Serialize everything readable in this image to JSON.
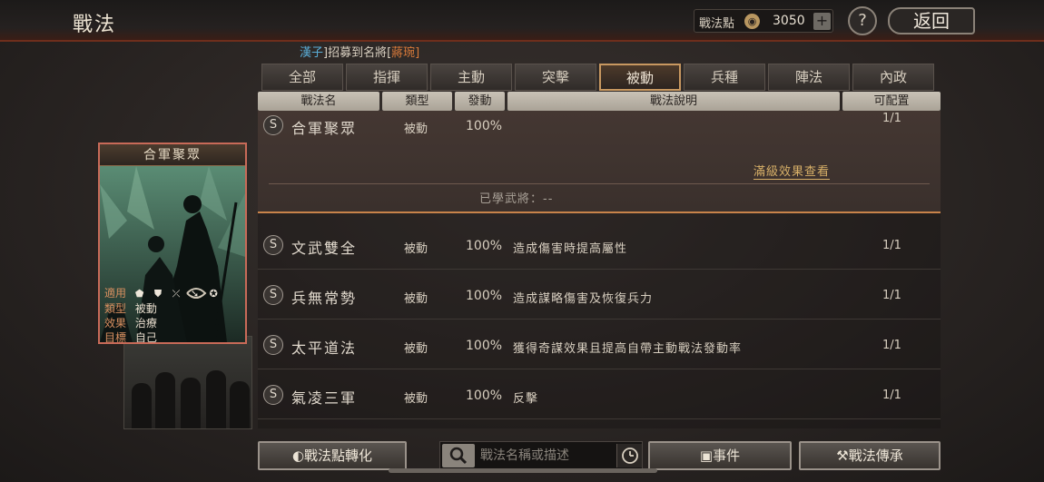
{
  "header": {
    "title": "戰法",
    "points_label": "戰法點",
    "points_value": "3050",
    "help_label": "?",
    "back_label": "返回"
  },
  "announcement": {
    "part1": "漢子",
    "part2": "]招募到名將[",
    "part3": "蔣琬]"
  },
  "tabs": [
    {
      "label": "全部"
    },
    {
      "label": "指揮"
    },
    {
      "label": "主動"
    },
    {
      "label": "突擊"
    },
    {
      "label": "被動"
    },
    {
      "label": "兵種"
    },
    {
      "label": "陣法"
    },
    {
      "label": "內政"
    }
  ],
  "active_tab": "被動",
  "columns": [
    "戰法名",
    "類型",
    "發動",
    "戰法說明",
    "可配置"
  ],
  "expanded": {
    "badge": "S",
    "name": "合軍聚眾",
    "type": "被動",
    "rate": "100%",
    "slots": "1/1",
    "full_effect_label": "滿級效果查看",
    "learned_label": "已學武將：--"
  },
  "rows": [
    {
      "badge": "S",
      "name": "文武雙全",
      "type": "被動",
      "rate": "100%",
      "desc": "造成傷害時提高屬性",
      "slots": "1/1"
    },
    {
      "badge": "S",
      "name": "兵無常勢",
      "type": "被動",
      "rate": "100%",
      "desc": "造成謀略傷害及恢復兵力",
      "slots": "1/1"
    },
    {
      "badge": "S",
      "name": "太平道法",
      "type": "被動",
      "rate": "100%",
      "desc": "獲得奇謀效果且提高自帶主動戰法發動率",
      "slots": "1/1"
    },
    {
      "badge": "S",
      "name": "氣凌三軍",
      "type": "被動",
      "rate": "100%",
      "desc": "反擊",
      "slots": "1/1"
    }
  ],
  "card": {
    "title": "合軍聚眾",
    "apply_label": "適用",
    "apply_icons": "⬟ ⛊ ⤫ ➘ ✪",
    "type_label": "類型",
    "type_value": "被動",
    "effect_label": "效果",
    "effect_value": "治療",
    "target_label": "目標",
    "target_value": "自己"
  },
  "bottom": {
    "convert_label": "戰法點轉化",
    "search_placeholder": "戰法名稱或描述",
    "event_label": "事件",
    "inherit_label": "戰法傳承"
  },
  "colors": {
    "accent": "#c89860",
    "highlight_border": "#c86a58",
    "link": "#d8b068"
  }
}
